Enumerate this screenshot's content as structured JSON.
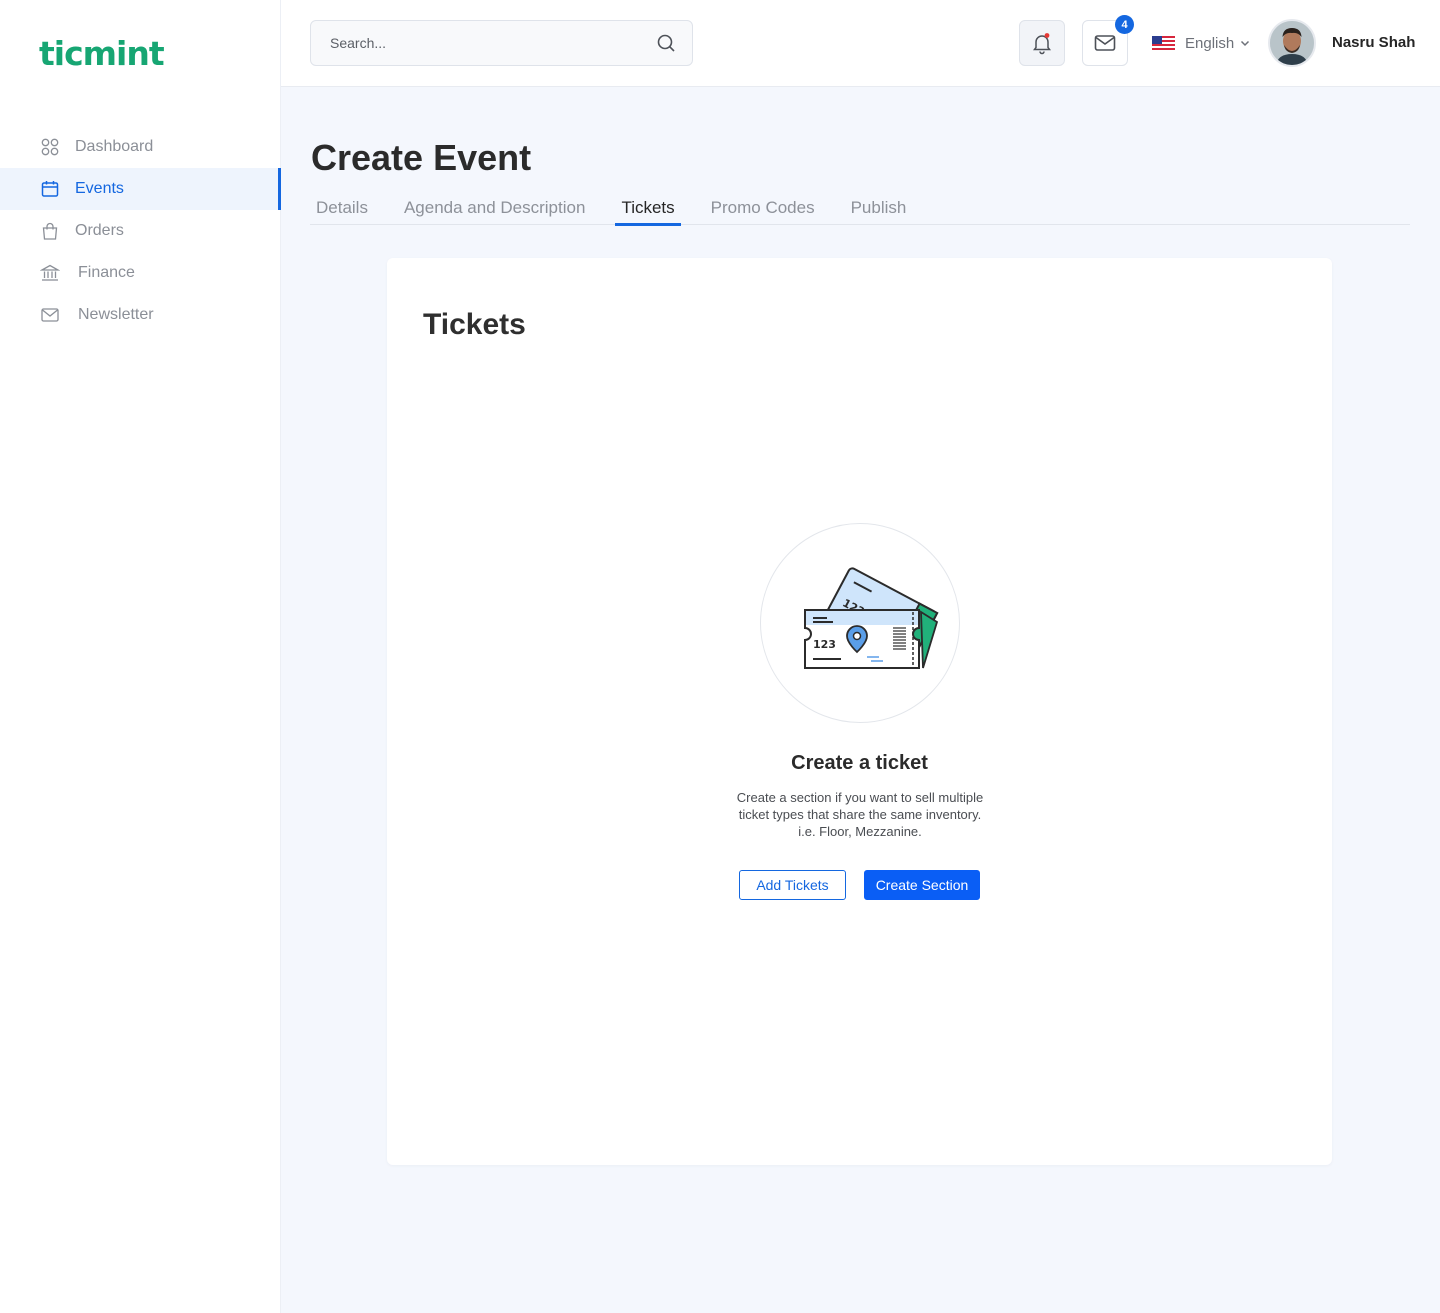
{
  "brand": {
    "logo_text": "ticmint",
    "color": "#17a673"
  },
  "sidebar": {
    "items": [
      {
        "label": "Dashboard",
        "icon": "grid-icon",
        "active": false
      },
      {
        "label": "Events",
        "icon": "calendar-icon",
        "active": true
      },
      {
        "label": "Orders",
        "icon": "shopping-bag-icon",
        "active": false
      },
      {
        "label": "Finance",
        "icon": "bank-icon",
        "active": false
      },
      {
        "label": "Newsletter",
        "icon": "mail-icon",
        "active": false
      }
    ]
  },
  "header": {
    "search": {
      "placeholder": "Search..."
    },
    "notifications": {
      "icon": "bell-icon",
      "has_unread_dot": true
    },
    "messages": {
      "icon": "mail-icon",
      "count": "4"
    },
    "language": {
      "label": "English",
      "flag": "us-flag-icon"
    },
    "user": {
      "name": "Nasru Shah"
    }
  },
  "main": {
    "title": "Create Event",
    "tabs": [
      {
        "label": "Details",
        "active": false
      },
      {
        "label": "Agenda and Description",
        "active": false
      },
      {
        "label": "Tickets",
        "active": true
      },
      {
        "label": "Promo Codes",
        "active": false
      },
      {
        "label": "Publish",
        "active": false
      }
    ],
    "card": {
      "title": "Tickets",
      "empty_state": {
        "ticket_number": "123",
        "heading": "Create a ticket",
        "description": "Create a section if you want to sell multiple ticket types that share the same inventory. i.e. Floor, Mezzanine.",
        "secondary_button": "Add Tickets",
        "primary_button": "Create Section"
      }
    }
  },
  "colors": {
    "accent": "#1467e0",
    "primary_button": "#0a5ef5",
    "background": "#f4f7fd"
  }
}
